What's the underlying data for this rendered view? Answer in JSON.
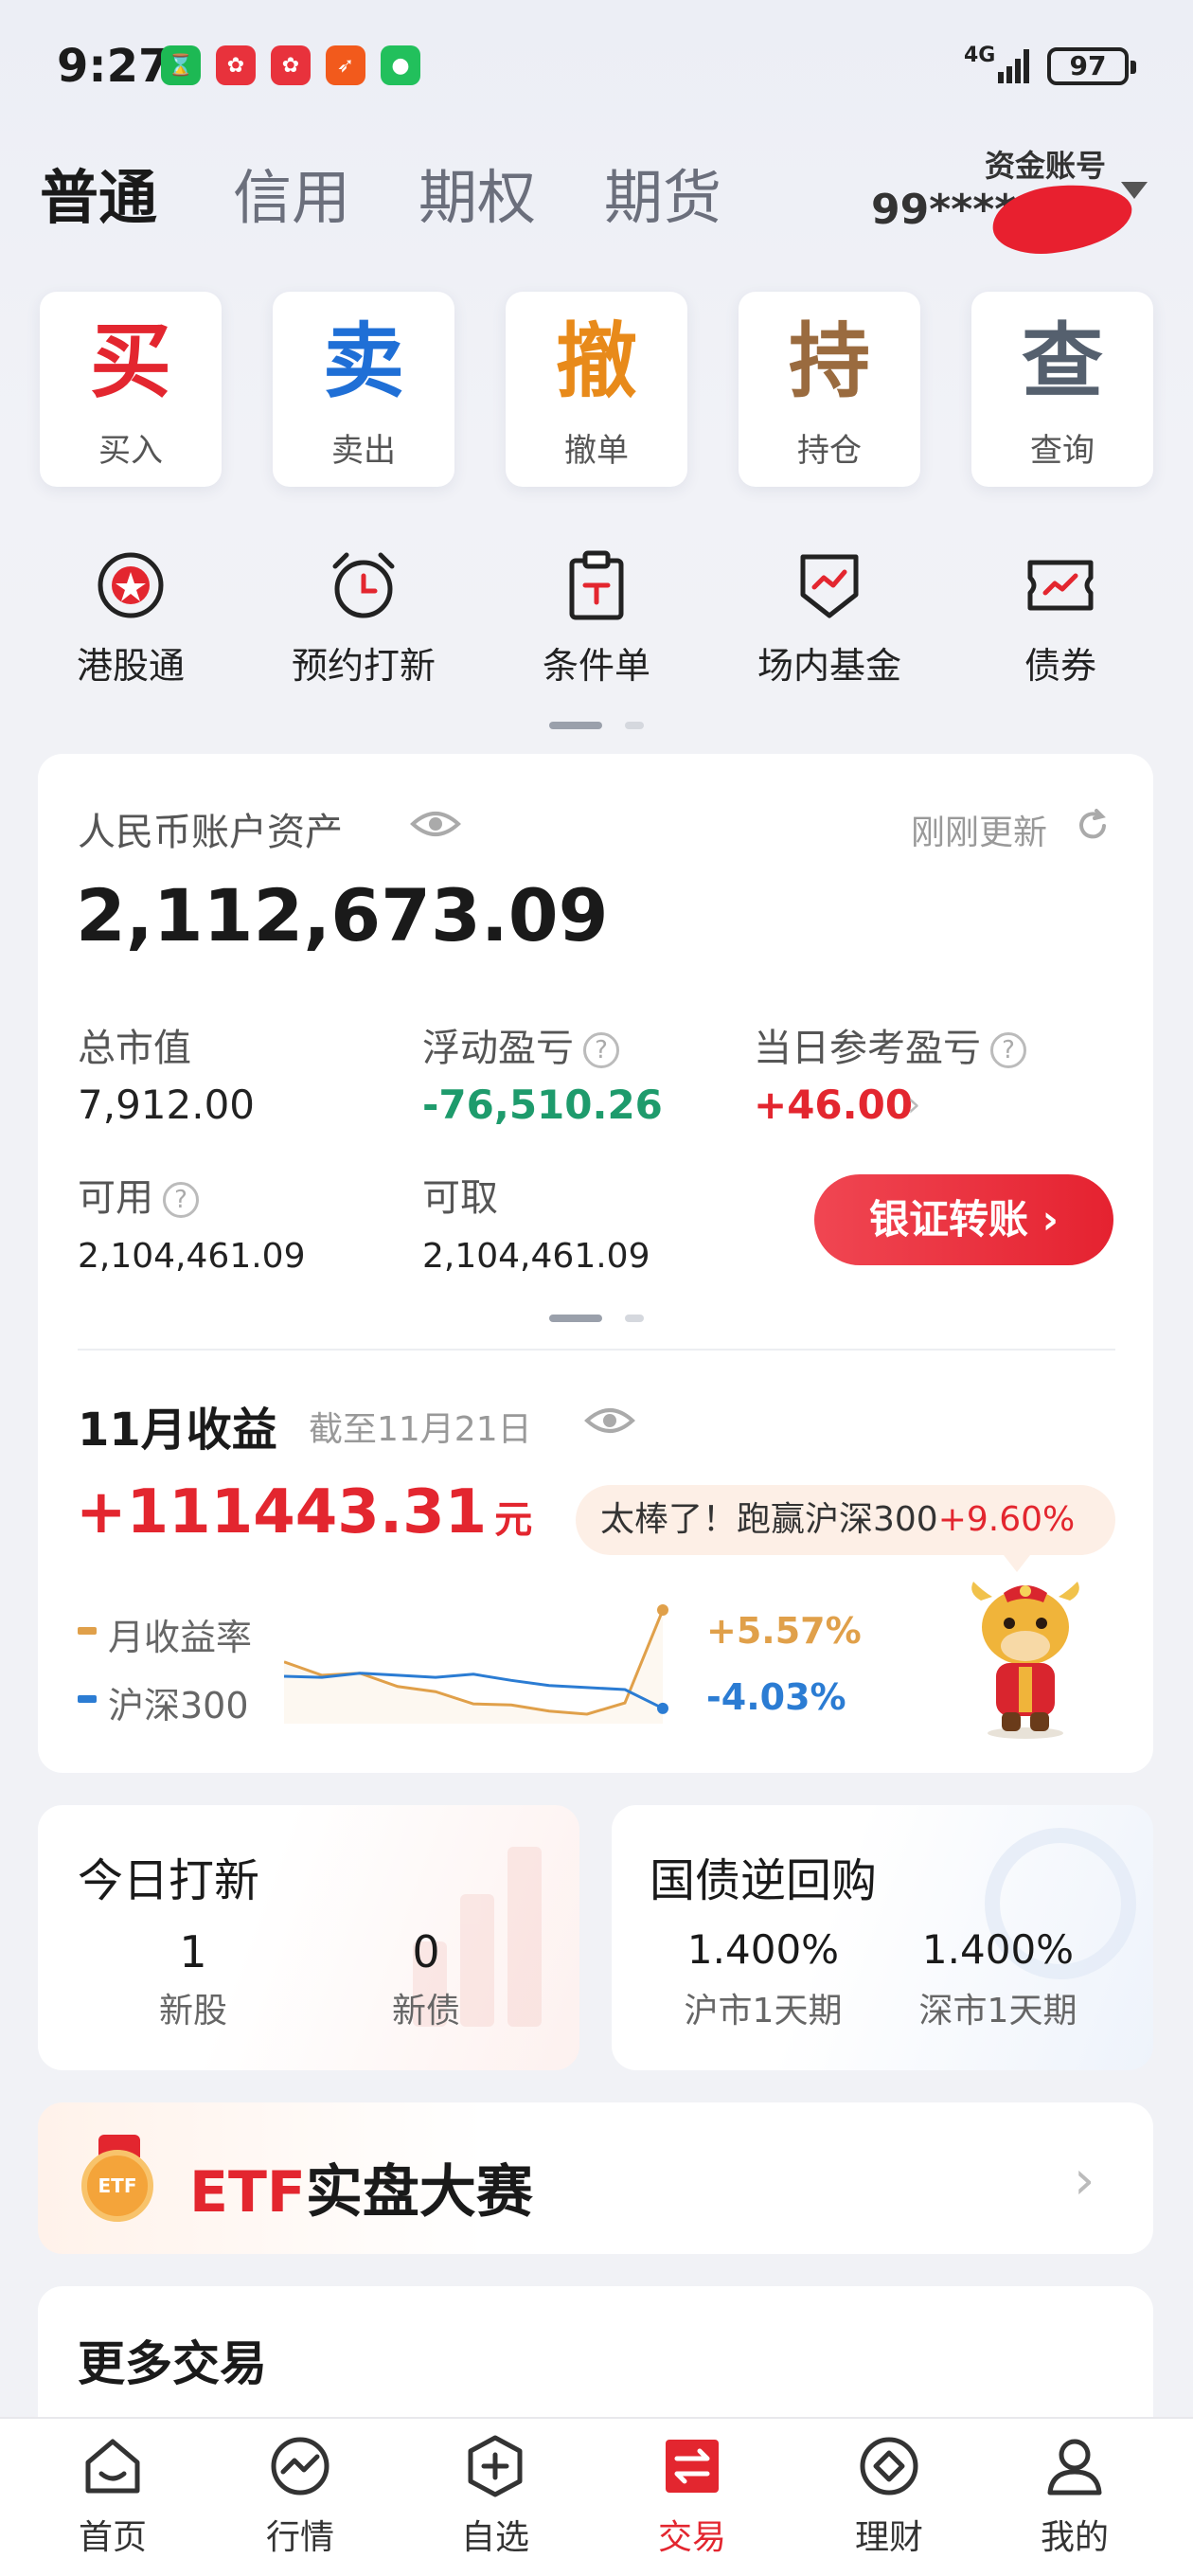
{
  "status_bar": {
    "time": "9:27",
    "network": "4G",
    "battery": "97",
    "app_icons": [
      {
        "name": "hourglass-app-icon",
        "color": "#1db954"
      },
      {
        "name": "huawei-app-icon",
        "color": "#e8323c"
      },
      {
        "name": "huawei-app-icon-2",
        "color": "#e8323c"
      },
      {
        "name": "kite-app-icon",
        "color": "#f25a1c"
      },
      {
        "name": "wechat-icon",
        "color": "#22c05c"
      }
    ]
  },
  "tabs": [
    "普通",
    "信用",
    "期权",
    "期货"
  ],
  "active_tab": "普通",
  "account": {
    "label": "资金账号",
    "number": "99****"
  },
  "actions": [
    {
      "big": "买",
      "label": "买入",
      "color": "#e3262f"
    },
    {
      "big": "卖",
      "label": "卖出",
      "color": "#1f6fd6"
    },
    {
      "big": "撤",
      "label": "撤单",
      "color": "#e88a1a"
    },
    {
      "big": "持",
      "label": "持仓",
      "color": "#9a6b3f"
    },
    {
      "big": "查",
      "label": "查询",
      "color": "#55606e"
    }
  ],
  "quick_items": [
    {
      "label": "港股通",
      "icon": "bauhinia-icon"
    },
    {
      "label": "预约打新",
      "icon": "alarm-clock-icon"
    },
    {
      "label": "条件单",
      "icon": "clipboard-icon"
    },
    {
      "label": "场内基金",
      "icon": "shield-chart-icon"
    },
    {
      "label": "债券",
      "icon": "ticket-chart-icon"
    }
  ],
  "asset": {
    "title": "人民币账户资产",
    "refresh": "刚刚更新",
    "total": "2,112,673.09",
    "market_value_label": "总市值",
    "market_value": "7,912.00",
    "float_pl_label": "浮动盈亏",
    "float_pl": "-76,510.26",
    "day_pl_label": "当日参考盈亏",
    "day_pl": "+46.00",
    "available_label": "可用",
    "available": "2,104,461.09",
    "withdrawable_label": "可取",
    "withdrawable": "2,104,461.09",
    "transfer_button": "银证转账"
  },
  "monthly": {
    "title": "11月收益",
    "as_of": "截至11月21日",
    "profit": "+111443.31",
    "unit": "元",
    "badge_text": "太棒了！跑赢沪深300",
    "badge_pct": "+9.60%",
    "legend_monthly": "月收益率",
    "legend_index": "沪深300",
    "monthly_pct": "+5.57%",
    "index_pct": "-4.03%",
    "monthly_color": "#e0a04a",
    "index_color": "#2b7cd3"
  },
  "chart_data": {
    "type": "line",
    "title": "",
    "xlabel": "",
    "ylabel": "",
    "series": [
      {
        "name": "月收益率",
        "values": [
          0.5,
          -0.8,
          -0.6,
          -1.9,
          -2.4,
          -3.6,
          -3.7,
          -4.3,
          -4.6,
          -3.5,
          5.57
        ]
      },
      {
        "name": "沪深300",
        "values": [
          -0.9,
          -1.0,
          -0.6,
          -0.8,
          -1.0,
          -0.7,
          -1.3,
          -1.8,
          -2.0,
          -2.2,
          -4.03
        ]
      }
    ]
  },
  "ipo": {
    "title": "今日打新",
    "new_stock_count": "1",
    "new_stock_label": "新股",
    "new_bond_count": "0",
    "new_bond_label": "新债"
  },
  "repo": {
    "title": "国债逆回购",
    "sh_rate": "1.400%",
    "sh_label": "沪市1天期",
    "sz_rate": "1.400%",
    "sz_label": "深市1天期"
  },
  "etf": {
    "prefix": "ETF",
    "title": "实盘大赛",
    "badge": "ETF"
  },
  "more": {
    "title": "更多交易"
  },
  "nav": [
    {
      "label": "首页",
      "icon": "home-icon"
    },
    {
      "label": "行情",
      "icon": "market-icon"
    },
    {
      "label": "自选",
      "icon": "watchlist-icon"
    },
    {
      "label": "交易",
      "icon": "trade-icon"
    },
    {
      "label": "理财",
      "icon": "wealth-icon"
    },
    {
      "label": "我的",
      "icon": "profile-icon"
    }
  ],
  "nav_active": "交易"
}
